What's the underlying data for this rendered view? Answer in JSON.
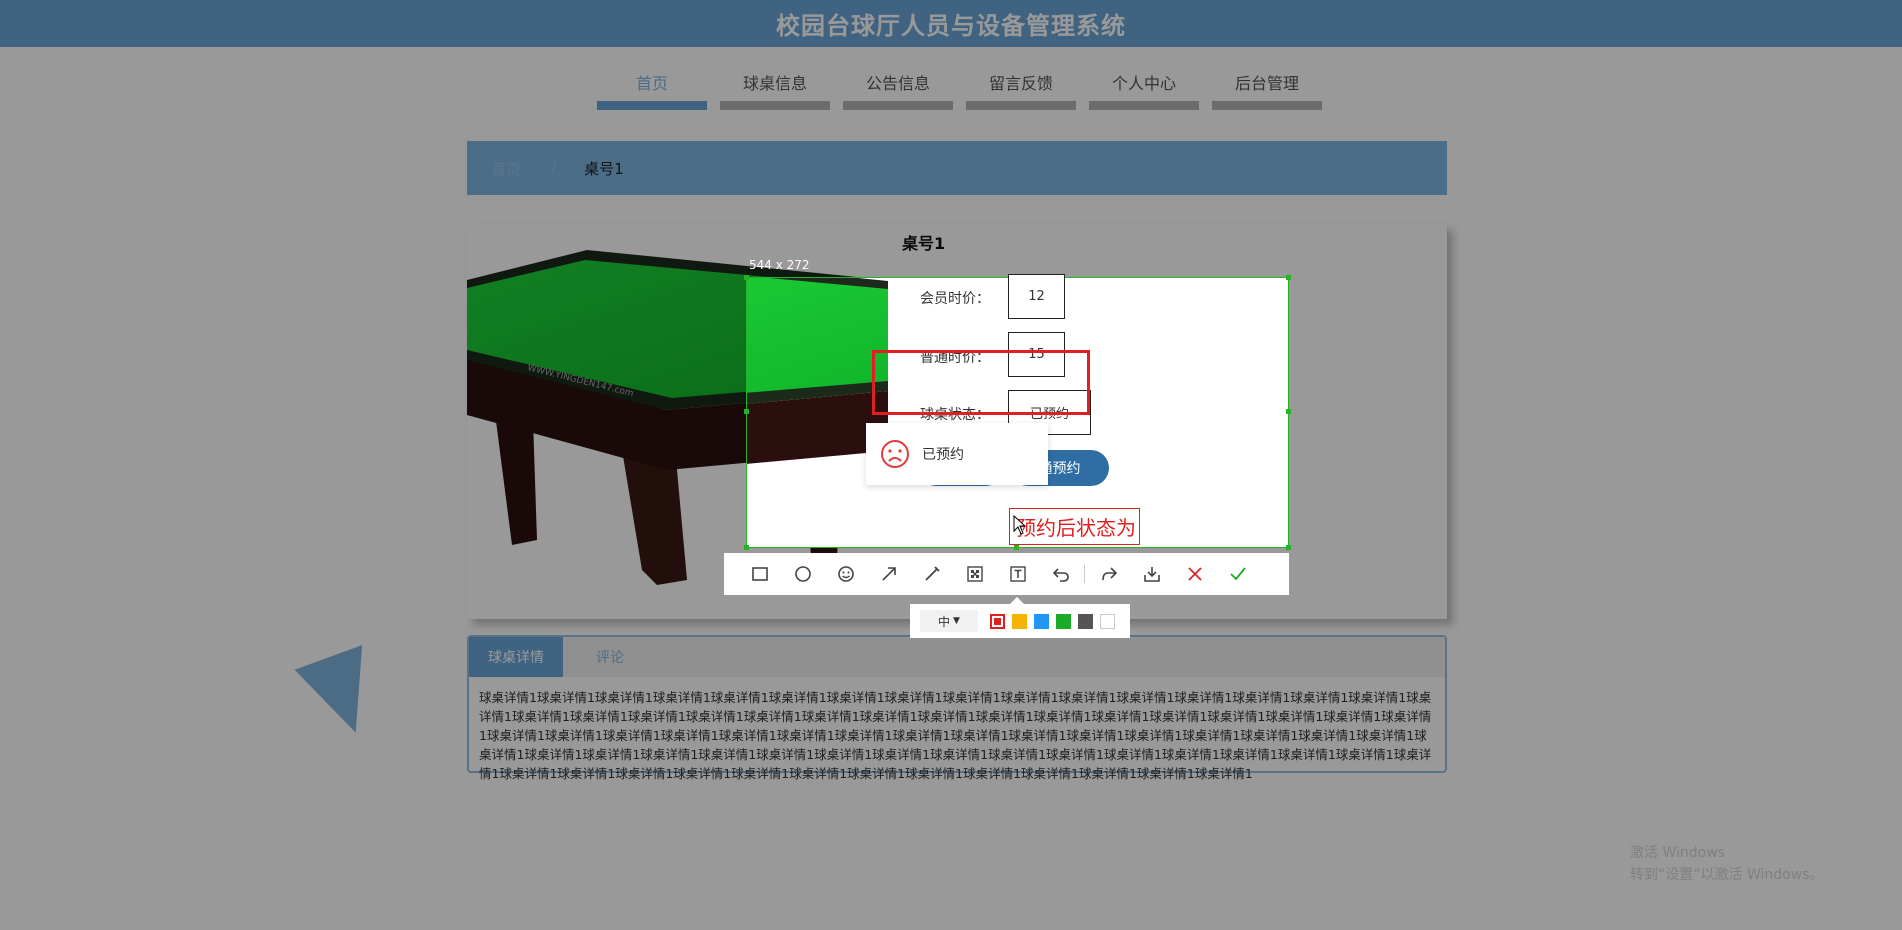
{
  "header": {
    "title": "校园台球厅人员与设备管理系统"
  },
  "nav": {
    "items": [
      {
        "label": "首页"
      },
      {
        "label": "球桌信息"
      },
      {
        "label": "公告信息"
      },
      {
        "label": "留言反馈"
      },
      {
        "label": "个人中心"
      },
      {
        "label": "后台管理"
      }
    ]
  },
  "breadcrumb": {
    "home": "首页",
    "separator": "/",
    "current": "桌号1"
  },
  "detail": {
    "title": "桌号1",
    "member_price_label": "会员时价：",
    "member_price": "12",
    "normal_price_label": "普通时价：",
    "normal_price": "15",
    "status_label": "球桌状态：",
    "status": "已预约",
    "book_button": "通预约"
  },
  "capture": {
    "size_label": "544 x 272"
  },
  "toast": {
    "text": "已预约"
  },
  "annotation": {
    "text": "预约后状态为"
  },
  "style_panel": {
    "size": "中",
    "colors": [
      "#e02020",
      "#f5b400",
      "#2196f3",
      "#1aab29",
      "#555555",
      "#ffffff"
    ]
  },
  "tabs": {
    "items": [
      {
        "label": "球桌详情"
      },
      {
        "label": "评论"
      }
    ]
  },
  "details_text": "球桌详情1球桌详情1球桌详情1球桌详情1球桌详情1球桌详情1球桌详情1球桌详情1球桌详情1球桌详情1球桌详情1球桌详情1球桌详情1球桌详情1球桌详情1球桌详情1球桌详情1球桌详情1球桌详情1球桌详情1球桌详情1球桌详情1球桌详情1球桌详情1球桌详情1球桌详情1球桌详情1球桌详情1球桌详情1球桌详情1球桌详情1球桌详情1球桌详情1球桌详情1球桌详情1球桌详情1球桌详情1球桌详情1球桌详情1球桌详情1球桌详情1球桌详情1球桌详情1球桌详情1球桌详情1球桌详情1球桌详情1球桌详情1球桌详情1球桌详情1球桌详情1球桌详情1球桌详情1球桌详情1球桌详情1球桌详情1球桌详情1球桌详情1球桌详情1球桌详情1球桌详情1球桌详情1球桌详情1球桌详情1球桌详情1球桌详情1球桌详情1球桌详情1球桌详情1球桌详情1球桌详情1球桌详情1球桌详情1球桌详情1球桌详情1球桌详情1球桌详情1球桌详情1球桌详情1",
  "watermark": {
    "line1": "激活 Windows",
    "line2": "转到“设置”以激活 Windows。"
  }
}
